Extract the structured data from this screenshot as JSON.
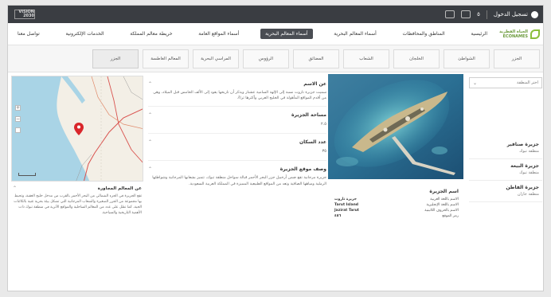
{
  "topbar": {
    "user_label": "تسجيل الدخول",
    "lang_number": "٥",
    "logo_text": "VISION 2030"
  },
  "brand": {
    "name_ar": "الحياة الفطرية",
    "name_en": "ECONAMES"
  },
  "nav": {
    "items": [
      {
        "label": "الرئيسية",
        "active": false
      },
      {
        "label": "المناطق والمحافظات",
        "active": false
      },
      {
        "label": "أسماء المعالم البحرية",
        "active": false
      },
      {
        "label": "أسماء المعالم البحرية",
        "active": true
      },
      {
        "label": "أسماء المواقع العامة",
        "active": false
      },
      {
        "label": "خريطة معالم المملكة",
        "active": false
      },
      {
        "label": "الخدمات الإلكترونية",
        "active": false
      },
      {
        "label": "تواصل معنا",
        "active": false
      }
    ]
  },
  "subtabs": [
    {
      "label": "الجزر",
      "active": false
    },
    {
      "label": "الشواطئ",
      "active": false
    },
    {
      "label": "الخلجان",
      "active": false
    },
    {
      "label": "الشعاب",
      "active": false
    },
    {
      "label": "المضائق",
      "active": false
    },
    {
      "label": "الرؤوس",
      "active": false
    },
    {
      "label": "المراسي البحرية",
      "active": false
    },
    {
      "label": "المعالم الغاطسة",
      "active": false
    },
    {
      "label": "الجزر",
      "active": true
    }
  ],
  "filter": {
    "placeholder": "اختر المنطقة"
  },
  "islands": [
    {
      "name": "جزيرة صنافير",
      "sub": "منطقة تبوك"
    },
    {
      "name": "جزيرة البيعة",
      "sub": "منطقة تبوك"
    },
    {
      "name": "جزيرة الفاطن",
      "sub": "منطقة جازان"
    }
  ],
  "details": {
    "about_title": "عن الاسم",
    "about_text": "سميت جزيرة تاروت نسبة إلى الإلهة السامية عشتار ويذكر أن تاريخها يعود إلى الألف الخامس قبل الميلاد، وهي من أقدم المواقع المأهولة في الخليج العربي وأكثرها ثراءً.",
    "area_title": "مساحة الجزيرة",
    "area_value": "٢.٥",
    "dist_title": "عدد السكان",
    "dist_value": "٣٥",
    "location_title": "وصف موقع الجزيرة",
    "location_text": "جزيرة مرجانية تقع ضمن أرخبيل جزر البحر الأحمر قبالة سواحل منطقة تبوك، تتميز بشعابها المرجانية وشواطئها الرملية ومياهها الصافية وتعد من المواقع الطبيعية المميزة في المملكة العربية السعودية."
  },
  "info": {
    "title": "اسم الجزيرة",
    "rows": [
      {
        "label": "الاسم باللغة العربية",
        "value": "جزيرة تاروت"
      },
      {
        "label": "الاسم باللغة الإنجليزية",
        "value": "Tarut Island"
      },
      {
        "label": "الاسم بالحروف اللاتينية",
        "value": "Jazirat Tarut"
      },
      {
        "label": "رمز الموقع",
        "value": "٤٥٦"
      }
    ]
  },
  "related": {
    "title": "عن المعالم المجاورة",
    "text": "تقع الجزيرة في الجزء الشمالي من البحر الأحمر بالقرب من مدخل خليج العقبة، وتحيط بها مجموعة من الجزر الصغيرة والشعاب المرجانية التي تشكل بيئة بحرية غنية بالكائنات الحية، كما تطل على عدد من المعالم الساحلية والمواقع الأثرية في منطقة تبوك ذات الأهمية التاريخية والسياحية."
  },
  "map": {
    "zoom_in": "+",
    "zoom_out": "−"
  }
}
